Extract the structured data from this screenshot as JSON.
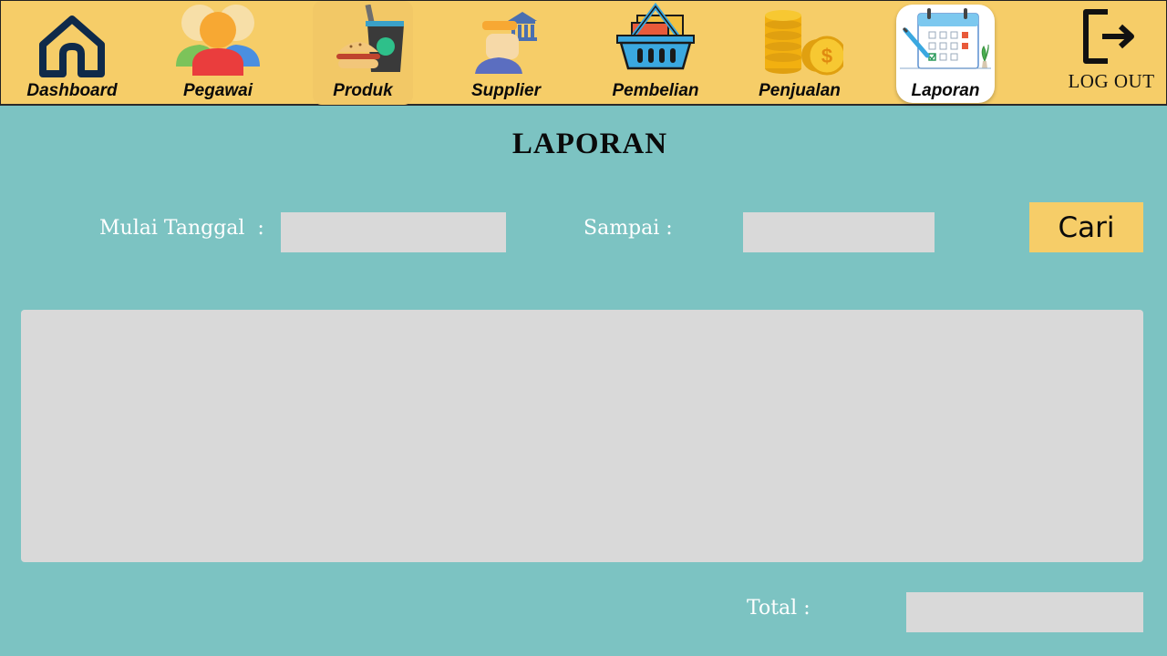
{
  "nav": {
    "items": [
      {
        "label": "Dashboard",
        "icon": "home-icon"
      },
      {
        "label": "Pegawai",
        "icon": "employees-icon"
      },
      {
        "label": "Produk",
        "icon": "food-drink-icon"
      },
      {
        "label": "Supplier",
        "icon": "supplier-icon"
      },
      {
        "label": "Pembelian",
        "icon": "shopping-basket-icon"
      },
      {
        "label": "Penjualan",
        "icon": "coins-icon"
      },
      {
        "label": "Laporan",
        "icon": "calendar-report-icon",
        "active": true
      }
    ],
    "logout_label": "LOG OUT",
    "logout_icon": "logout-icon"
  },
  "page": {
    "title": "LAPORAN"
  },
  "filter": {
    "start_label": "Mulai Tanggal  :",
    "start_value": "",
    "end_label": "Sampai :",
    "end_value": "",
    "search_button": "Cari"
  },
  "footer": {
    "total_label": "Total :",
    "total_value": ""
  },
  "colors": {
    "navbar": "#f6cd68",
    "background": "#7cc3c2",
    "field": "#d9d9d9",
    "button": "#f6cd68"
  }
}
